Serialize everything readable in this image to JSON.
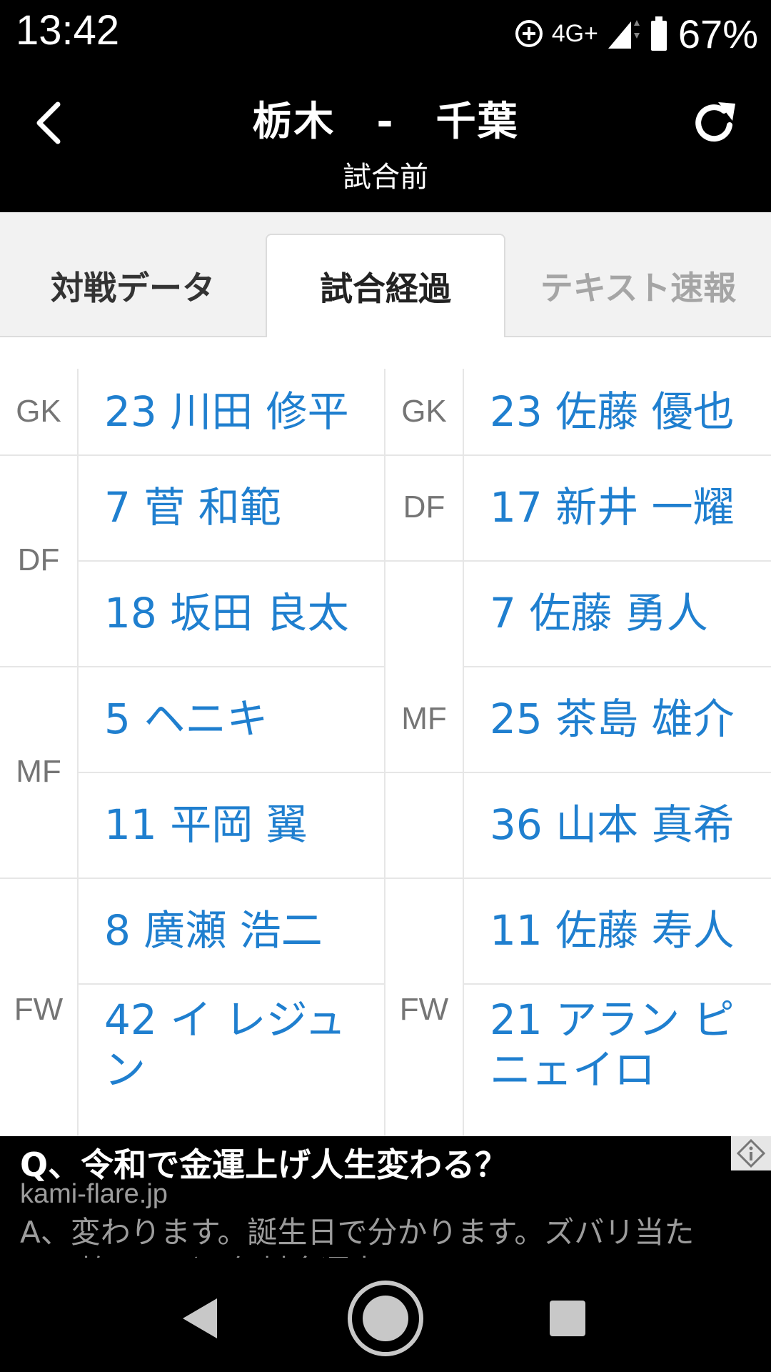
{
  "status_bar": {
    "time": "13:42",
    "network": "4G+",
    "battery": "67%"
  },
  "header": {
    "title": "栃木　-　千葉",
    "status": "試合前",
    "back_icon": "chevron-left-icon",
    "refresh_icon": "refresh-icon"
  },
  "tabs": [
    {
      "label": "対戦データ"
    },
    {
      "label": "試合経過"
    },
    {
      "label": "テキスト速報"
    }
  ],
  "lineup": {
    "home": {
      "positions": [
        "GK",
        "DF",
        "MF",
        "FW"
      ],
      "players": [
        "23 川田 修平",
        "7 菅 和範",
        "18 坂田 良太",
        "5 ヘニキ",
        "11 平岡 翼",
        "8 廣瀬 浩二",
        "42 イ レジュン"
      ]
    },
    "away": {
      "positions": [
        "GK",
        "DF",
        "MF",
        "FW"
      ],
      "players": [
        "23 佐藤 優也",
        "17 新井 一耀",
        "7 佐藤 勇人",
        "25 茶島 雄介",
        "36 山本 真希",
        "11 佐藤 寿人",
        "21 アラン ピニェイロ"
      ]
    }
  },
  "ad": {
    "title": "Q、令和で金運上げ人生変わる？",
    "domain": "kami-flare.jp",
    "description": "A、変わります。誕生日で分かります。ズバリ当たる！怖いほど…無料金運占い"
  },
  "colors": {
    "player_link": "#1f7fcf",
    "position_label": "#757575"
  }
}
